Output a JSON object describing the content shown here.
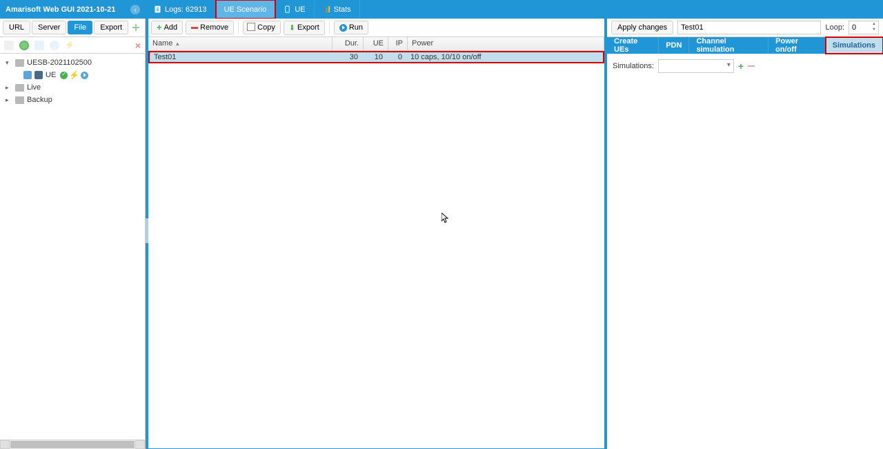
{
  "header": {
    "title": "Amarisoft Web GUI 2021-10-21"
  },
  "mainTabs": {
    "logs": "Logs: 62913",
    "ueScenario": "UE Scenario",
    "ue": "UE",
    "stats": "Stats"
  },
  "leftToolbar": {
    "url": "URL",
    "server": "Server",
    "file": "File",
    "export": "Export"
  },
  "tree": {
    "root": "UESB-2021102500",
    "ueNode": "UE",
    "live": "Live",
    "backup": "Backup"
  },
  "centerToolbar": {
    "add": "Add",
    "remove": "Remove",
    "copy": "Copy",
    "export": "Export",
    "run": "Run"
  },
  "gridHeaders": {
    "name": "Name",
    "dur": "Dur.",
    "ue": "UE",
    "ip": "IP",
    "power": "Power"
  },
  "gridRow": {
    "name": "Test01",
    "dur": "30",
    "ue": "10",
    "ip": "0",
    "power": "10 caps, 10/10 on/off"
  },
  "rightTop": {
    "applyChanges": "Apply changes",
    "nameValue": "Test01",
    "loopLabel": "Loop:",
    "loopValue": "0"
  },
  "rightTabs": {
    "createUEs": "Create UEs",
    "pdn": "PDN",
    "channel": "Channel simulation",
    "power": "Power on/off",
    "simulations": "Simulations"
  },
  "rightBody": {
    "simulationsLabel": "Simulations:"
  }
}
